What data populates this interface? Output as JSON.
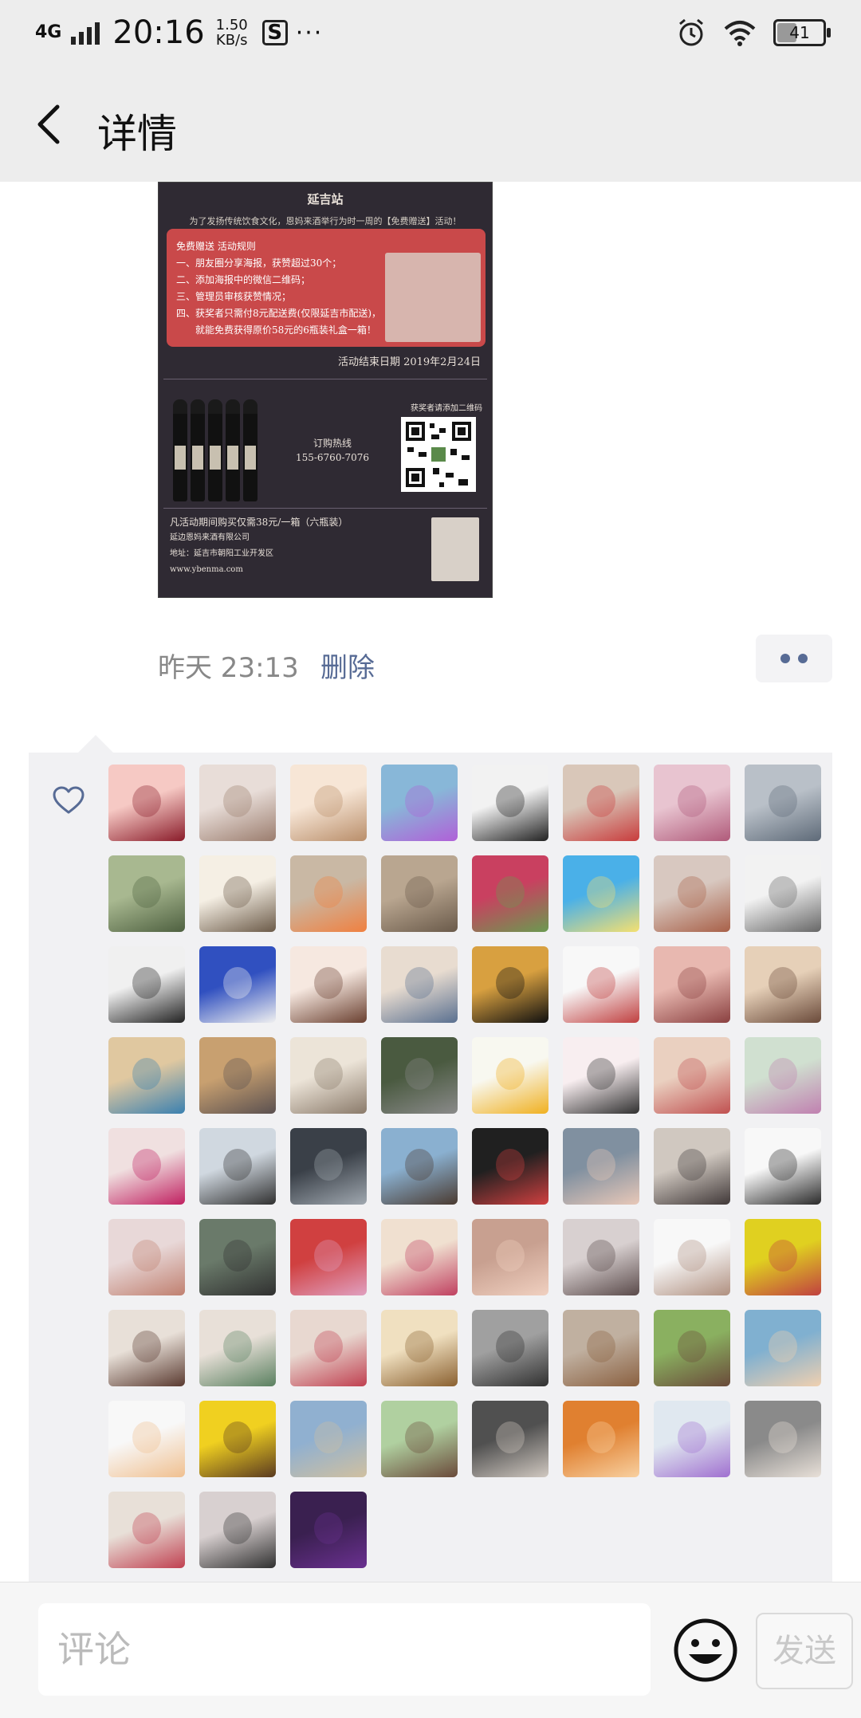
{
  "status_bar": {
    "network": "4G",
    "time": "20:16",
    "speed_value": "1.50",
    "speed_unit": "KB/s",
    "sim_icon": "S",
    "more": "···",
    "battery": "41"
  },
  "nav": {
    "title": "详情"
  },
  "poster": {
    "title": "延吉站",
    "intro": "为了发扬传统饮食文化，恩妈来酒举行为时一周的【免费赠送】活动！",
    "rules_heading": "免费赠送 活动规则",
    "rules": [
      "一、朋友圈分享海报，获赞超过30个；",
      "二、添加海报中的微信二维码；",
      "三、管理员审核获赞情况；",
      "四、获奖者只需付8元配送费(仅限延吉市配送)，",
      "　　就能免费获得原价58元的6瓶装礼盒一箱！"
    ],
    "end_date": "活动结束日期 2019年2月24日",
    "qr_label": "获奖者请添加二维码",
    "hotline_label": "订购热线",
    "hotline_number": "155-6760-7076",
    "footer_offer": "凡活动期间购买仅需38元/一箱（六瓶装）",
    "company": "延边恩妈来酒有限公司",
    "address": "地址：延吉市朝阳工业开发区",
    "website": "www.ybenma.com"
  },
  "meta": {
    "time": "昨天 23:13",
    "delete": "删除"
  },
  "likes": {
    "avatar_count": 67,
    "avatar_colors": [
      [
        "#f6c9c4",
        "#8a1c2a"
      ],
      [
        "#e8ddd8",
        "#9b7d6e"
      ],
      [
        "#f7e6d6",
        "#b98e6a"
      ],
      [
        "#88b7d8",
        "#b060d8"
      ],
      [
        "#f2f2f2",
        "#222222"
      ],
      [
        "#d9c7b9",
        "#c83c3c"
      ],
      [
        "#e8c4d0",
        "#b05a7a"
      ],
      [
        "#b9c0c8",
        "#5e6a78"
      ],
      [
        "#a8b890",
        "#4e6040"
      ],
      [
        "#f5efe4",
        "#6b5a48"
      ],
      [
        "#c9b8a4",
        "#f08040"
      ],
      [
        "#b9a690",
        "#6a5a4a"
      ],
      [
        "#c94060",
        "#6a9a50"
      ],
      [
        "#4ab0e8",
        "#f5e070"
      ],
      [
        "#d8c8c0",
        "#a86048"
      ],
      [
        "#f2f2f2",
        "#666666"
      ],
      [
        "#f0f0f0",
        "#222222"
      ],
      [
        "#3050c0",
        "#f0f0f0"
      ],
      [
        "#f6e8e0",
        "#6a4030"
      ],
      [
        "#e8dcd0",
        "#5a7090"
      ],
      [
        "#d8a040",
        "#101010"
      ],
      [
        "#f8f8f8",
        "#c04040"
      ],
      [
        "#e8b8b0",
        "#8a4040"
      ],
      [
        "#e6d0b8",
        "#6a4a3a"
      ],
      [
        "#e0c8a0",
        "#3a80b0"
      ],
      [
        "#c8a070",
        "#5a5050"
      ],
      [
        "#ece4d8",
        "#8a7a6a"
      ],
      [
        "#4a5a40",
        "#8a8a8a"
      ],
      [
        "#f8f8f0",
        "#f0b020"
      ],
      [
        "#f8eef0",
        "#303030"
      ],
      [
        "#ead0c0",
        "#c05050"
      ],
      [
        "#d0e0d0",
        "#c080b0"
      ],
      [
        "#f0e0e0",
        "#c02060"
      ],
      [
        "#d0d8e0",
        "#303030"
      ],
      [
        "#3a4048",
        "#a0a8b0"
      ],
      [
        "#8ab0d0",
        "#4a3a30"
      ],
      [
        "#202020",
        "#d04040"
      ],
      [
        "#8090a0",
        "#e8c8b8"
      ],
      [
        "#d0c8c0",
        "#403838"
      ],
      [
        "#f8f8f8",
        "#2a2a2a"
      ],
      [
        "#e8d8d8",
        "#c08070"
      ],
      [
        "#6a7a6a",
        "#303030"
      ],
      [
        "#d04040",
        "#e0a0c0"
      ],
      [
        "#f0e0d0",
        "#c04060"
      ],
      [
        "#c8a090",
        "#f0d0c0"
      ],
      [
        "#d8d0d0",
        "#5a4a4a"
      ],
      [
        "#f8f8f8",
        "#b09080"
      ],
      [
        "#e0d020",
        "#c04040"
      ],
      [
        "#e8e0d8",
        "#5a3a30"
      ],
      [
        "#e8e0d8",
        "#5a8060"
      ],
      [
        "#e8d8d0",
        "#c04050"
      ],
      [
        "#f0e0c0",
        "#8a6030"
      ],
      [
        "#a0a0a0",
        "#303030"
      ],
      [
        "#c0b0a0",
        "#8a6040"
      ],
      [
        "#8ab060",
        "#6a4a3a"
      ],
      [
        "#80b0d0",
        "#f0d0b0"
      ],
      [
        "#f8f8f8",
        "#f0c090"
      ],
      [
        "#f0d020",
        "#5a3a20"
      ],
      [
        "#90b0d0",
        "#d0c0a0"
      ],
      [
        "#b0d0a0",
        "#6a4a3a"
      ],
      [
        "#505050",
        "#d0c8c0"
      ],
      [
        "#e08030",
        "#f8d0a0"
      ],
      [
        "#e0e8f0",
        "#a070d0"
      ],
      [
        "#8a8a8a",
        "#e8e0d8"
      ],
      [
        "#e8e0d8",
        "#c04050"
      ],
      [
        "#d8d0d0",
        "#303030"
      ],
      [
        "#3a2050",
        "#6a3090"
      ]
    ]
  },
  "comment": {
    "placeholder": "评论",
    "send": "发送"
  }
}
